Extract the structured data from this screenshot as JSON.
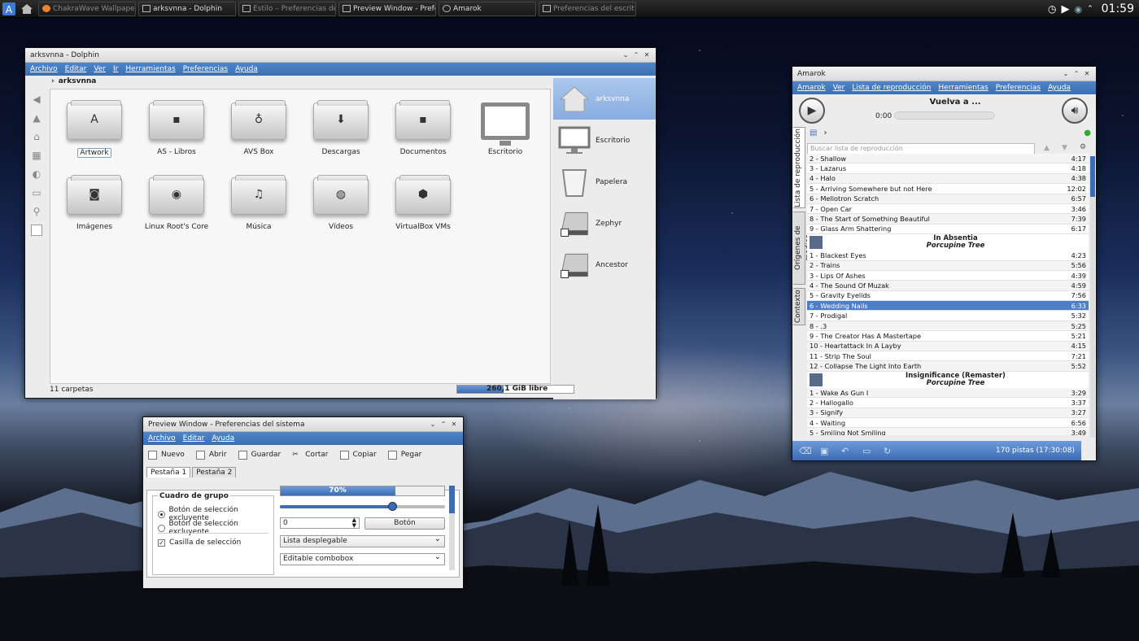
{
  "taskbar": {
    "tasks": [
      {
        "label": "ChakraWave Wallpaper K",
        "dim": true
      },
      {
        "label": "arksvnna - Dolphin",
        "dim": false
      },
      {
        "label": "Estilo – Preferencias de",
        "dim": true
      },
      {
        "label": "Preview Window - Prefer",
        "dim": false
      },
      {
        "label": "Amarok",
        "dim": false
      },
      {
        "label": "Preferencias del escrit",
        "dim": true
      }
    ],
    "clock": "01:59"
  },
  "dolphin": {
    "title": "arksvnna - Dolphin",
    "menu": [
      "Archivo",
      "Editar",
      "Ver",
      "Ir",
      "Herramientas",
      "Preferencias",
      "Ayuda"
    ],
    "breadcrumb": "arksvnna",
    "folders": [
      {
        "label": "Artwork",
        "icon": "artwork-icon",
        "glyph": "A"
      },
      {
        "label": "AS - Libros",
        "icon": "books-icon",
        "glyph": "▪"
      },
      {
        "label": "AVS Box",
        "icon": "avs-icon",
        "glyph": "♁"
      },
      {
        "label": "Descargas",
        "icon": "download-icon",
        "glyph": "⬇"
      },
      {
        "label": "Documentos",
        "icon": "document-icon",
        "glyph": "▪"
      },
      {
        "label": "Escritorio",
        "icon": "desktop-icon",
        "glyph": ""
      },
      {
        "label": "Imágenes",
        "icon": "camera-icon",
        "glyph": "◙"
      },
      {
        "label": "Linux Root's Core",
        "icon": "eye-icon",
        "glyph": "◉"
      },
      {
        "label": "Música",
        "icon": "music-icon",
        "glyph": "♫"
      },
      {
        "label": "Vídeos",
        "icon": "video-icon",
        "glyph": "◍"
      },
      {
        "label": "VirtualBox VMs",
        "icon": "virtualbox-icon",
        "glyph": "⬢"
      }
    ],
    "places": [
      {
        "label": "arksvnna",
        "icon": "home-icon",
        "selected": true
      },
      {
        "label": "Escritorio",
        "icon": "desktop-icon",
        "selected": false
      },
      {
        "label": "Papelera",
        "icon": "trash-icon",
        "selected": false
      },
      {
        "label": "Zephyr",
        "icon": "drive-icon",
        "selected": false
      },
      {
        "label": "Ancestor",
        "icon": "drive-icon",
        "selected": false
      }
    ],
    "status": "11 carpetas",
    "free_space": "260,1 GiB libre",
    "free_fraction": 0.4
  },
  "amarok": {
    "title": "Amarok",
    "menu": [
      "Amarok",
      "Ver",
      "Lista de reproducción",
      "Herramientas",
      "Preferencias",
      "Ayuda"
    ],
    "now_playing": "Vuelva a ...",
    "elapsed": "0:00",
    "search_placeholder": "Buscar lista de reproducción",
    "side_tabs": [
      "Lista de reproducción",
      "Orígenes de medios",
      "Contexto"
    ],
    "groups": [
      {
        "album": "",
        "artist": "",
        "tracks": [
          {
            "name": "2 - Shallow",
            "length": "4:17"
          },
          {
            "name": "3 - Lazarus",
            "length": "4:18"
          },
          {
            "name": "4 - Halo",
            "length": "4:38"
          },
          {
            "name": "5 - Arriving Somewhere but not Here",
            "length": "12:02"
          },
          {
            "name": "6 - Mellotron Scratch",
            "length": "6:57"
          },
          {
            "name": "7 - Open Car",
            "length": "3:46"
          },
          {
            "name": "8 - The Start of Something Beautiful",
            "length": "7:39"
          },
          {
            "name": "9 - Glass Arm Shattering",
            "length": "6:17"
          }
        ]
      },
      {
        "album": "In Absentia",
        "artist": "Porcupine Tree",
        "tracks": [
          {
            "name": "1 - Blackest Eyes",
            "length": "4:23"
          },
          {
            "name": "2 - Trains",
            "length": "5:56"
          },
          {
            "name": "3 - Lips Of Ashes",
            "length": "4:39"
          },
          {
            "name": "4 - The Sound Of Muzak",
            "length": "4:59"
          },
          {
            "name": "5 - Gravity Eyelids",
            "length": "7:56"
          },
          {
            "name": "6 - Wedding Nails",
            "length": "6:33",
            "selected": true
          },
          {
            "name": "7 - Prodigal",
            "length": "5:32"
          },
          {
            "name": "8 - .3",
            "length": "5:25"
          },
          {
            "name": "9 - The Creator Has A Mastertape",
            "length": "5:21"
          },
          {
            "name": "10 - Heartattack In A Layby",
            "length": "4:15"
          },
          {
            "name": "11 - Strip The Soul",
            "length": "7:21"
          },
          {
            "name": "12 - Collapse The Light Into Earth",
            "length": "5:52"
          }
        ]
      },
      {
        "album": "Insignificance (Remaster)",
        "artist": "Porcupine Tree",
        "tracks": [
          {
            "name": "1 - Wake As Gun I",
            "length": "3:29"
          },
          {
            "name": "2 - Hallogallo",
            "length": "3:37"
          },
          {
            "name": "3 - Signify",
            "length": "3:27"
          },
          {
            "name": "4 - Waiting",
            "length": "6:56"
          },
          {
            "name": "5 - Smiling Not Smiling",
            "length": "3:49"
          }
        ]
      }
    ],
    "footer": "170 pistas (17:30:08)"
  },
  "preview": {
    "title": "Preview Window - Preferencias del sistema",
    "menu": [
      "Archivo",
      "Editar",
      "Ayuda"
    ],
    "toolbar": [
      "Nuevo",
      "Abrir",
      "Guardar",
      "Cortar",
      "Copiar",
      "Pegar"
    ],
    "tabs": [
      "Pestaña 1",
      "Pestaña 2"
    ],
    "group_title": "Cuadro de grupo",
    "radio1": "Botón de selección excluyente",
    "radio2": "Botón de selección excluyente",
    "checkbox": "Casilla de selección",
    "progress_label": "70%",
    "progress": 0.7,
    "slider": 0.68,
    "spin_value": "0",
    "button": "Botón",
    "dropdown": "Lista desplegable",
    "editable": "Editable combobox"
  }
}
